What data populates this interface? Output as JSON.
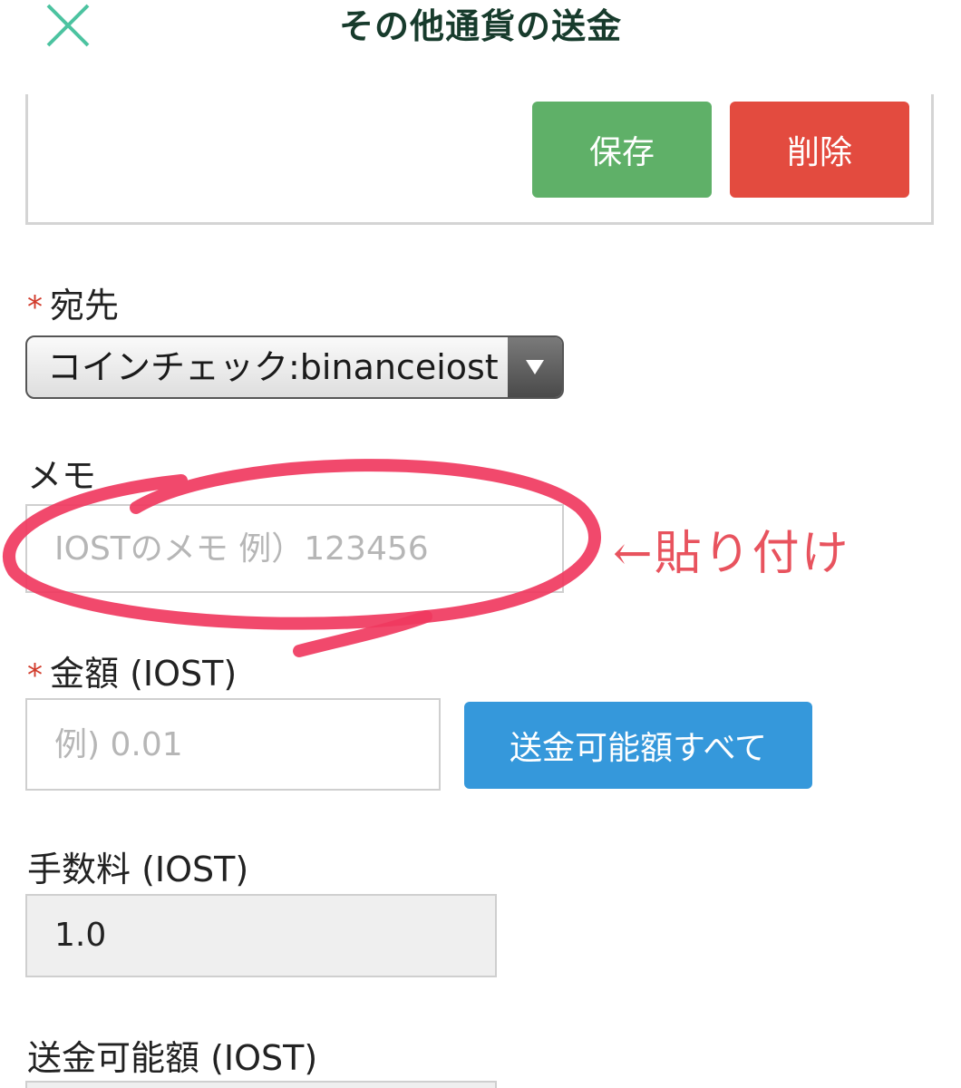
{
  "header": {
    "title": "その他通貨の送金"
  },
  "address_card": {
    "save_label": "保存",
    "delete_label": "削除"
  },
  "destination": {
    "required_mark": "*",
    "label": "宛先",
    "selected_value": "コインチェック:binanceiost"
  },
  "memo": {
    "label": "メモ",
    "placeholder": "IOSTのメモ 例）123456"
  },
  "amount": {
    "required_mark": "*",
    "label": "金額 (IOST)",
    "placeholder": "例) 0.01",
    "send_all_label": "送金可能額すべて"
  },
  "fee": {
    "label": "手数料 (IOST)",
    "value": "1.0"
  },
  "available": {
    "label": "送金可能額 (IOST)"
  },
  "annotation": {
    "note": "←貼り付け",
    "color": "#e8535e"
  },
  "colors": {
    "save": "#5fb068",
    "delete": "#e34b3f",
    "send_all": "#3598db",
    "title": "#173b2c",
    "close_icon": "#4cc3a0"
  }
}
